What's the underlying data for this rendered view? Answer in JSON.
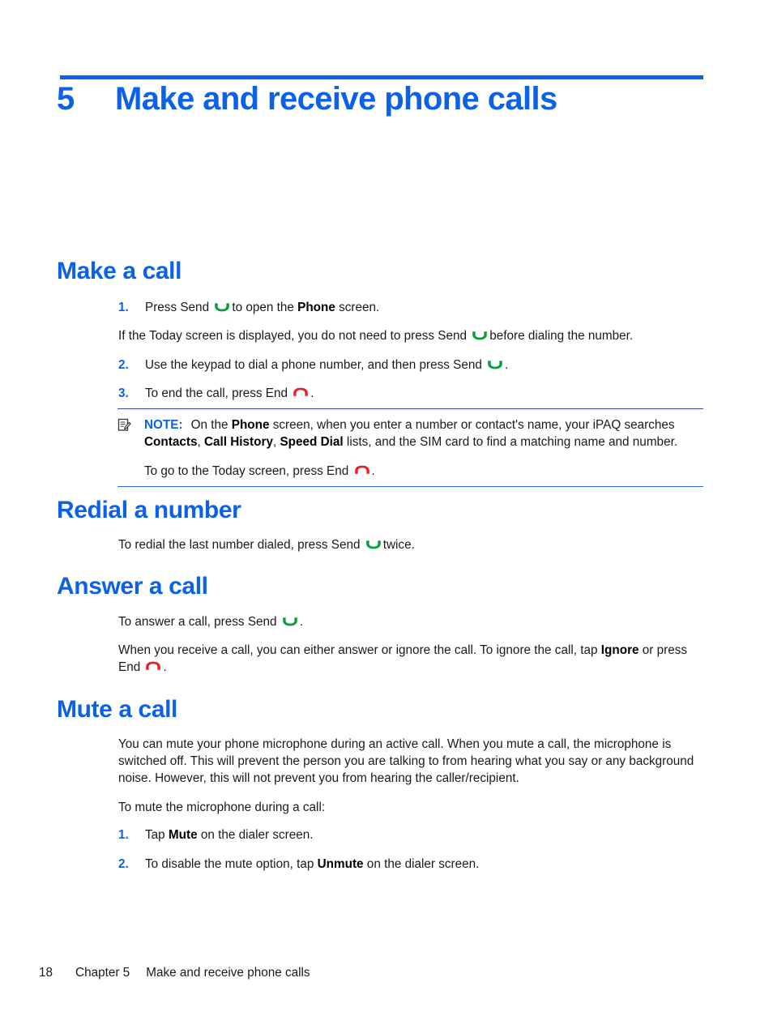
{
  "colors": {
    "accent_blue": "#0b61e8",
    "send_green": "#0a9d3f",
    "end_red": "#e81f24",
    "note_rule": "#2a6ae0",
    "body_text": "#1a1a1a"
  },
  "chapter": {
    "number": "5",
    "title": "Make and receive phone calls"
  },
  "sections": [
    {
      "id": "make-a-call",
      "heading": "Make a call",
      "steps": [
        {
          "number": "1.",
          "parts": [
            {
              "type": "text",
              "value": "Press Send "
            },
            {
              "type": "icon",
              "value": "send-phone-icon"
            },
            {
              "type": "text",
              "value": "to open the "
            },
            {
              "type": "bold",
              "value": "Phone"
            },
            {
              "type": "text",
              "value": " screen."
            }
          ]
        },
        {
          "number": "2.",
          "parts": [
            {
              "type": "text",
              "value": "Use the keypad to dial a phone number, and then press Send "
            },
            {
              "type": "icon",
              "value": "send-phone-icon"
            },
            {
              "type": "text",
              "value": "."
            }
          ]
        },
        {
          "number": "3.",
          "parts": [
            {
              "type": "text",
              "value": "To end the call, press End "
            },
            {
              "type": "icon",
              "value": "end-phone-icon"
            },
            {
              "type": "text",
              "value": "."
            }
          ]
        }
      ],
      "sub_paragraph": {
        "parts": [
          {
            "type": "text",
            "value": "If the Today screen is displayed, you do not need to press Send "
          },
          {
            "type": "icon",
            "value": "send-phone-icon"
          },
          {
            "type": "text",
            "value": "before dialing the number."
          }
        ]
      }
    },
    {
      "id": "redial-a-number",
      "heading": "Redial a number",
      "paragraph": {
        "parts": [
          {
            "type": "text",
            "value": "To redial the last number dialed, press Send "
          },
          {
            "type": "icon",
            "value": "send-phone-icon"
          },
          {
            "type": "text",
            "value": "twice."
          }
        ]
      }
    },
    {
      "id": "answer-a-call",
      "heading": "Answer a call",
      "paragraph_1": {
        "parts": [
          {
            "type": "text",
            "value": "To answer a call, press Send "
          },
          {
            "type": "icon",
            "value": "send-phone-icon"
          },
          {
            "type": "text",
            "value": "."
          }
        ]
      },
      "paragraph_2": {
        "parts": [
          {
            "type": "text",
            "value": "When you receive a call, you can either answer or ignore the call. To ignore the call, tap "
          },
          {
            "type": "bold",
            "value": "Ignore"
          },
          {
            "type": "text",
            "value": " or press End "
          },
          {
            "type": "icon",
            "value": "end-phone-icon"
          },
          {
            "type": "text",
            "value": "."
          }
        ]
      }
    },
    {
      "id": "mute-a-call",
      "heading": "Mute a call",
      "paragraph_1": {
        "parts": [
          {
            "type": "text",
            "value": "You can mute your phone microphone during an active call. When you mute a call, the microphone is switched off. This will prevent the person you are talking to from hearing what you say or any background noise. However, this will not prevent you from hearing the caller/recipient."
          }
        ]
      },
      "paragraph_2": {
        "parts": [
          {
            "type": "text",
            "value": "To mute the microphone during a call:"
          }
        ]
      },
      "steps": [
        {
          "number": "1.",
          "parts": [
            {
              "type": "text",
              "value": "Tap "
            },
            {
              "type": "bold",
              "value": "Mute"
            },
            {
              "type": "text",
              "value": " on the dialer screen."
            }
          ]
        },
        {
          "number": "2.",
          "parts": [
            {
              "type": "text",
              "value": "To disable the mute option, tap "
            },
            {
              "type": "bold",
              "value": "Unmute"
            },
            {
              "type": "text",
              "value": " on the dialer screen."
            }
          ]
        }
      ]
    }
  ],
  "note": {
    "icon": "note-pencil-icon",
    "label": "NOTE:",
    "body_parts": [
      {
        "type": "text",
        "value": "On the "
      },
      {
        "type": "bold",
        "value": "Phone"
      },
      {
        "type": "text",
        "value": " screen, when you enter a number or contact's name, your iPAQ searches "
      },
      {
        "type": "bold",
        "value": "Contacts"
      },
      {
        "type": "text",
        "value": ", "
      },
      {
        "type": "bold",
        "value": "Call History"
      },
      {
        "type": "text",
        "value": ", "
      },
      {
        "type": "bold",
        "value": "Speed Dial"
      },
      {
        "type": "text",
        "value": " lists, and the SIM card to find a matching name and number."
      }
    ],
    "tail_parts": [
      {
        "type": "text",
        "value": "To go to the Today screen, press End "
      },
      {
        "type": "icon",
        "value": "end-phone-icon"
      },
      {
        "type": "text",
        "value": "."
      }
    ]
  },
  "footer": {
    "page_number": "18",
    "chapter_label": "Chapter 5",
    "chapter_title": "Make and receive phone calls"
  }
}
